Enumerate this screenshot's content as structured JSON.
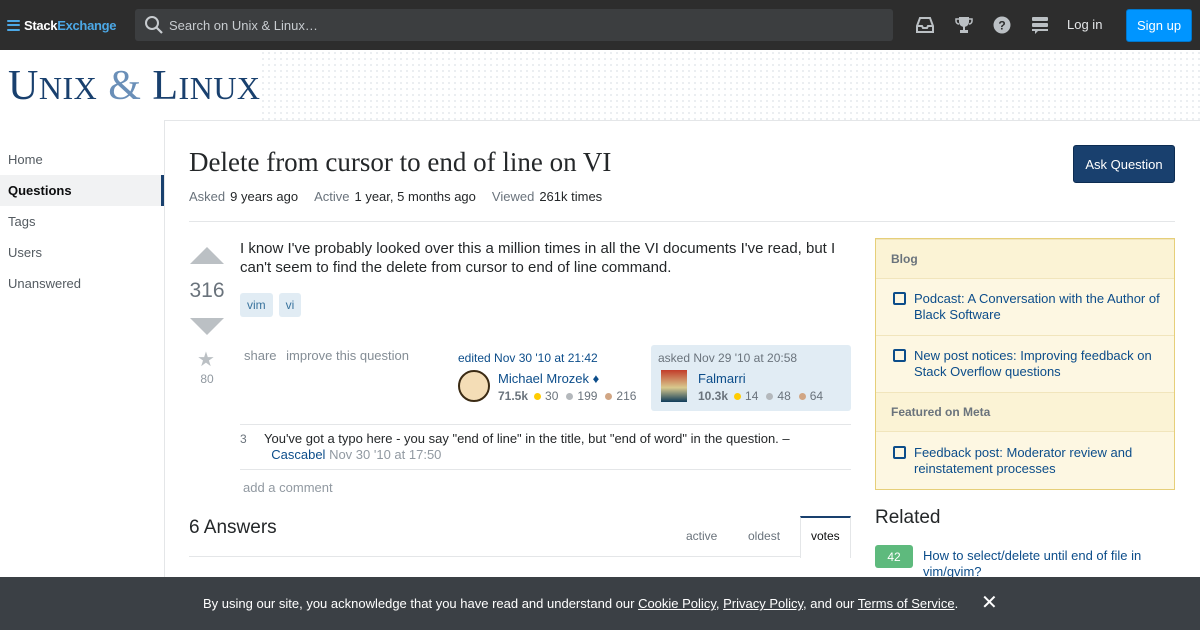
{
  "topbar": {
    "logo_word1": "Stack",
    "logo_word2": "Exchange",
    "search_placeholder": "Search on Unix & Linux…",
    "icons": [
      "inbox-icon",
      "achievements-icon",
      "help-icon",
      "site-switcher-icon"
    ],
    "login_label": "Log in",
    "signup_label": "Sign up"
  },
  "site": {
    "title_big_1": "U",
    "title_small_1": "NIX",
    "title_amp": " & ",
    "title_big_2": "L",
    "title_small_2": "INUX"
  },
  "leftnav": {
    "items": [
      {
        "label": "Home"
      },
      {
        "label": "Questions"
      },
      {
        "label": "Tags"
      },
      {
        "label": "Users"
      },
      {
        "label": "Unanswered"
      }
    ]
  },
  "question": {
    "title": "Delete from cursor to end of line on VI",
    "ask_button": "Ask Question",
    "meta": {
      "asked_label": "Asked",
      "asked_value": "9 years ago",
      "active_label": "Active",
      "active_value": "1 year, 5 months ago",
      "viewed_label": "Viewed",
      "viewed_value": "261k times"
    },
    "votes": "316",
    "favorites": "80",
    "body": "I know I've probably looked over this a million times in all the VI documents I've read, but I can't seem to find the delete from cursor to end of line command.",
    "tags": [
      "vim",
      "vi"
    ],
    "menu": [
      "share",
      "improve this question"
    ],
    "edited": {
      "time": "edited Nov 30 '10 at 21:42",
      "user": "Michael Mrozek ♦",
      "rep": "71.5k",
      "gold": "30",
      "silver": "199",
      "bronze": "216"
    },
    "asked": {
      "time": "asked Nov 29 '10 at 20:58",
      "user": "Falmarri",
      "rep": "10.3k",
      "gold": "14",
      "silver": "48",
      "bronze": "64"
    },
    "comment": {
      "score": "3",
      "text": "You've got a typo here - you say \"end of line\" in the title, but \"end of word\" in the question. –",
      "user": "Cascabel",
      "date": "Nov 30 '10 at 17:50"
    },
    "add_comment": "add a comment"
  },
  "answers": {
    "heading": "6 Answers",
    "tabs": [
      "active",
      "oldest",
      "votes"
    ],
    "active_tab": "votes"
  },
  "sidebar": {
    "blog_heading": "Blog",
    "blog_items": [
      "Podcast: A Conversation with the Author of Black Software",
      "New post notices: Improving feedback on Stack Overflow questions"
    ],
    "meta_heading": "Featured on Meta",
    "meta_items": [
      "Feedback post: Moderator review and reinstatement processes"
    ],
    "related_heading": "Related",
    "related": [
      {
        "score": "42",
        "title": "How to select/delete until end of file in vim/gvim?"
      }
    ]
  },
  "cookie": {
    "prefix": "By using our site, you acknowledge that you have read and understand our ",
    "cookie_policy": "Cookie Policy",
    "sep1": ", ",
    "privacy_policy": "Privacy Policy",
    "sep2": ", and our ",
    "terms": "Terms of Service",
    "suffix": ".",
    "close": "✕"
  },
  "colors": {
    "topbar": "#2d2d2d",
    "brand_blue": "#19406e",
    "link": "#0c4d8a",
    "signup": "#0095ff",
    "tag_bg": "#e1ecf4",
    "accepted_green": "#5eba7d"
  }
}
